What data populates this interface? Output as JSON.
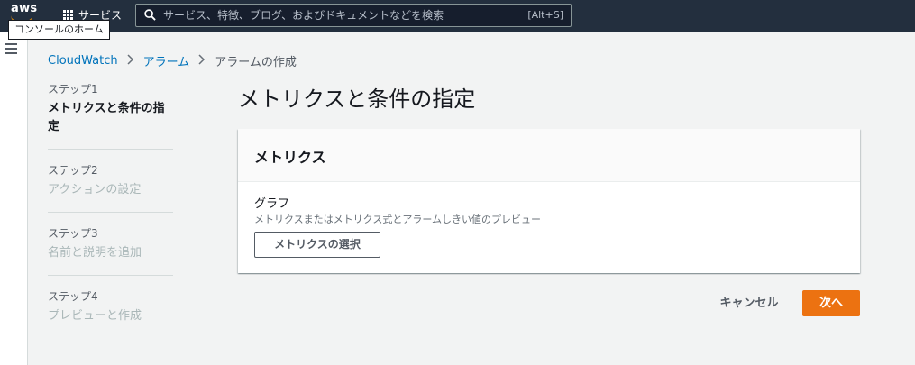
{
  "topnav": {
    "logo": "aws",
    "services_label": "サービス",
    "search": {
      "placeholder": "サービス、特徴、ブログ、およびドキュメントなどを検索",
      "value": "",
      "shortcut": "[Alt+S]"
    },
    "tooltip": "コンソールのホーム",
    "colors": {
      "background": "#232f3e",
      "logo_smile": "#ff9900"
    }
  },
  "breadcrumb": [
    {
      "label": "CloudWatch",
      "link": true
    },
    {
      "label": "アラーム",
      "link": true
    },
    {
      "label": "アラームの作成",
      "link": false
    }
  ],
  "steps": [
    {
      "number": "ステップ1",
      "title": "メトリクスと条件の指定",
      "active": true
    },
    {
      "number": "ステップ2",
      "title": "アクションの設定",
      "active": false
    },
    {
      "number": "ステップ3",
      "title": "名前と説明を追加",
      "active": false
    },
    {
      "number": "ステップ4",
      "title": "プレビューと作成",
      "active": false
    }
  ],
  "main": {
    "title": "メトリクスと条件の指定",
    "card": {
      "title": "メトリクス",
      "graph_label": "グラフ",
      "graph_description": "メトリクスまたはメトリクス式とアラームしきい値のプレビュー",
      "select_button": "メトリクスの選択"
    },
    "actions": {
      "cancel": "キャンセル",
      "next": "次へ"
    }
  },
  "icons": {
    "services": "grid-icon",
    "search": "search-icon",
    "menu": "hamburger-icon",
    "breadcrumb_separator": "chevron-right-icon"
  },
  "colors": {
    "primary_button": "#ec7211",
    "link": "#0073bb"
  }
}
